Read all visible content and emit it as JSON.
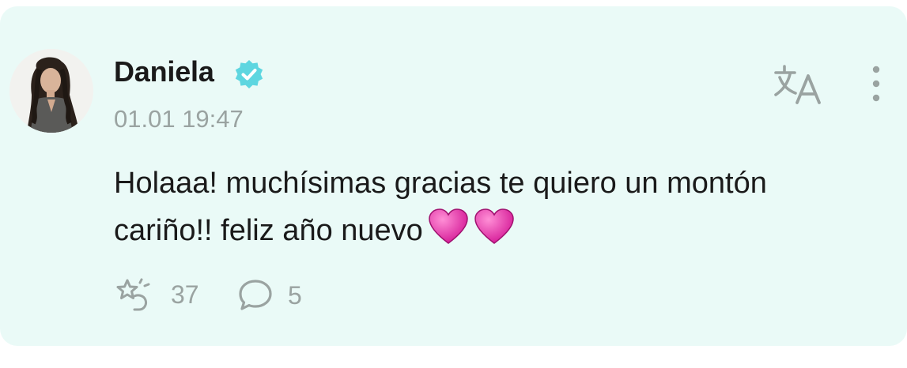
{
  "post": {
    "author": "Daniela",
    "verified": true,
    "timestamp": "01.01 19:47",
    "text": "Holaaa! muchísimas gracias te quiero un montón cariño!! feliz año nuevo",
    "emojis": [
      "pink-heart",
      "pink-heart"
    ],
    "stats": {
      "likes": "37",
      "comments": "5"
    }
  },
  "colors": {
    "card_background": "#eafaf7",
    "verified_badge": "#5ed6e0",
    "muted": "#9aa3a1",
    "heart": "#e83fb0"
  },
  "icons": {
    "verified": "verified-badge-icon",
    "translate": "translate-icon",
    "more": "more-vertical-icon",
    "like": "like-sparkle-icon",
    "comment": "comment-bubble-icon"
  }
}
